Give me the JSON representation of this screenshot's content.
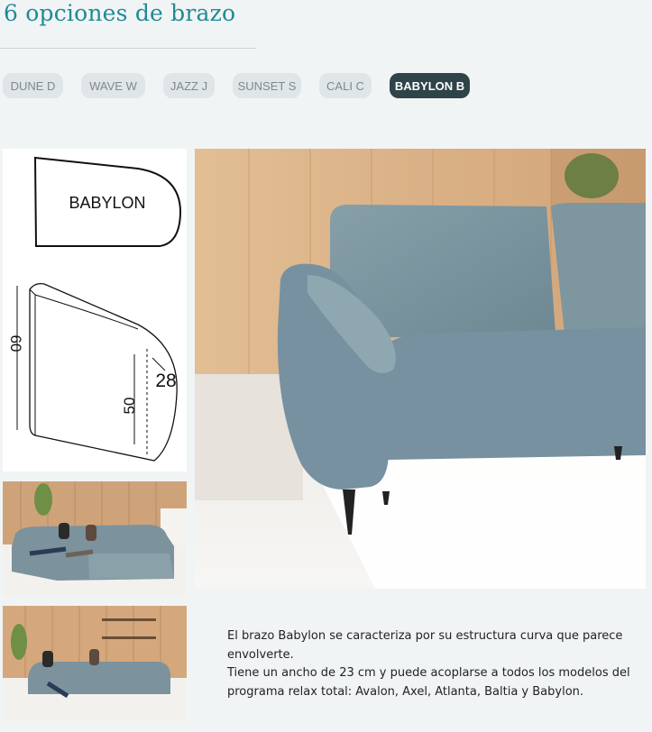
{
  "heading": {
    "title": "6 opciones de brazo"
  },
  "tabs": [
    {
      "label": "DUNE D",
      "active": false
    },
    {
      "label": "WAVE W",
      "active": false
    },
    {
      "label": "JAZZ J",
      "active": false
    },
    {
      "label": "SUNSET S",
      "active": false
    },
    {
      "label": "CALI C",
      "active": false
    },
    {
      "label": "BABYLON B",
      "active": true
    }
  ],
  "diagram": {
    "name_label": "BABYLON",
    "dim_height_total": "60",
    "dim_height_side": "50",
    "dim_width": "28"
  },
  "description": {
    "paragraph_1": "El brazo Babylon se caracteriza por su estructura curva que parece envolverte.",
    "paragraph_2": "Tiene un ancho de 23 cm y puede acoplarse a todos los modelos del programa relax total: Avalon, Axel, Atlanta, Baltia y Babylon."
  },
  "colors": {
    "title": "#1e8b96",
    "tab_bg": "#e0e5e7",
    "tab_active_bg": "#2e4448",
    "page_bg": "#f1f4f5"
  }
}
